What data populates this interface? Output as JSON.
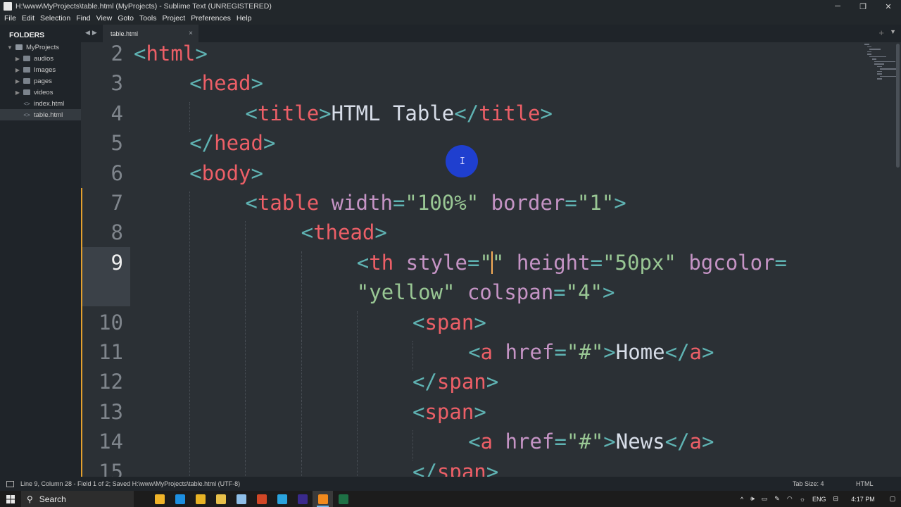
{
  "window": {
    "title": "H:\\www\\MyProjects\\table.html (MyProjects) - Sublime Text (UNREGISTERED)",
    "minimize": "─",
    "restore": "❐",
    "close": "✕"
  },
  "menu": [
    "File",
    "Edit",
    "Selection",
    "Find",
    "View",
    "Goto",
    "Tools",
    "Project",
    "Preferences",
    "Help"
  ],
  "sidebar": {
    "title": "FOLDERS",
    "project": "MyProjects",
    "folders": [
      "audios",
      "Images",
      "pages",
      "videos"
    ],
    "files": [
      "index.html",
      "table.html"
    ],
    "selected_file": "table.html"
  },
  "tabs": [
    {
      "label": "table.html",
      "active": true
    }
  ],
  "editor": {
    "lines": [
      {
        "n": "2",
        "tokens": [
          [
            "p",
            "<"
          ],
          [
            "t",
            "html"
          ],
          [
            "p",
            ">"
          ]
        ]
      },
      {
        "n": "3",
        "tokens": [
          [
            "p",
            "<"
          ],
          [
            "t",
            "head"
          ],
          [
            "p",
            ">"
          ]
        ]
      },
      {
        "n": "4",
        "tokens": [
          [
            "p",
            "<"
          ],
          [
            "t",
            "title"
          ],
          [
            "p",
            ">"
          ],
          [
            "x",
            "HTML Table"
          ],
          [
            "p",
            "</"
          ],
          [
            "t",
            "title"
          ],
          [
            "p",
            ">"
          ]
        ]
      },
      {
        "n": "5",
        "tokens": [
          [
            "p",
            "</"
          ],
          [
            "t",
            "head"
          ],
          [
            "p",
            ">"
          ]
        ]
      },
      {
        "n": "6",
        "tokens": [
          [
            "p",
            "<"
          ],
          [
            "t",
            "body"
          ],
          [
            "p",
            ">"
          ]
        ]
      },
      {
        "n": "7",
        "tokens": [
          [
            "p",
            "<"
          ],
          [
            "t",
            "table"
          ],
          [
            "x",
            " "
          ],
          [
            "a",
            "width"
          ],
          [
            "e",
            "="
          ],
          [
            "s",
            "\"100%\""
          ],
          [
            "x",
            " "
          ],
          [
            "a",
            "border"
          ],
          [
            "e",
            "="
          ],
          [
            "s",
            "\"1\""
          ],
          [
            "p",
            ">"
          ]
        ]
      },
      {
        "n": "8",
        "tokens": [
          [
            "p",
            "<"
          ],
          [
            "t",
            "thead"
          ],
          [
            "p",
            ">"
          ]
        ]
      },
      {
        "n": "9",
        "tokens": [
          [
            "p",
            "<"
          ],
          [
            "t",
            "th"
          ],
          [
            "x",
            " "
          ],
          [
            "a",
            "style"
          ],
          [
            "e",
            "="
          ],
          [
            "s",
            "\""
          ],
          [
            "caret",
            ""
          ],
          [
            "s",
            "\""
          ],
          [
            "x",
            " "
          ],
          [
            "a",
            "height"
          ],
          [
            "e",
            "="
          ],
          [
            "s",
            "\"50px\""
          ],
          [
            "x",
            " "
          ],
          [
            "a",
            "bgcolor"
          ],
          [
            "e",
            "="
          ]
        ]
      },
      {
        "n": "",
        "tokens": [
          [
            "s",
            "\"yellow\""
          ],
          [
            "x",
            " "
          ],
          [
            "a",
            "colspan"
          ],
          [
            "e",
            "="
          ],
          [
            "s",
            "\"4\""
          ],
          [
            "p",
            ">"
          ]
        ]
      },
      {
        "n": "10",
        "tokens": [
          [
            "p",
            "<"
          ],
          [
            "t",
            "span"
          ],
          [
            "p",
            ">"
          ]
        ]
      },
      {
        "n": "11",
        "tokens": [
          [
            "p",
            "<"
          ],
          [
            "t",
            "a"
          ],
          [
            "x",
            " "
          ],
          [
            "a",
            "href"
          ],
          [
            "e",
            "="
          ],
          [
            "s",
            "\"#\""
          ],
          [
            "p",
            ">"
          ],
          [
            "x",
            "Home"
          ],
          [
            "p",
            "</"
          ],
          [
            "t",
            "a"
          ],
          [
            "p",
            ">"
          ]
        ]
      },
      {
        "n": "12",
        "tokens": [
          [
            "p",
            "</"
          ],
          [
            "t",
            "span"
          ],
          [
            "p",
            ">"
          ]
        ]
      },
      {
        "n": "13",
        "tokens": [
          [
            "p",
            "<"
          ],
          [
            "t",
            "span"
          ],
          [
            "p",
            ">"
          ]
        ]
      },
      {
        "n": "14",
        "tokens": [
          [
            "p",
            "<"
          ],
          [
            "t",
            "a"
          ],
          [
            "x",
            " "
          ],
          [
            "a",
            "href"
          ],
          [
            "e",
            "="
          ],
          [
            "s",
            "\"#\""
          ],
          [
            "p",
            ">"
          ],
          [
            "x",
            "News"
          ],
          [
            "p",
            "</"
          ],
          [
            "t",
            "a"
          ],
          [
            "p",
            ">"
          ]
        ]
      },
      {
        "n": "15",
        "tokens": [
          [
            "p",
            "</"
          ],
          [
            "t",
            "span"
          ],
          [
            "p",
            ">"
          ]
        ]
      }
    ]
  },
  "status": {
    "left": "Line 9, Column 28 - Field 1 of 2; Saved H:\\www\\MyProjects\\table.html (UTF-8)",
    "tab_size": "Tab Size: 4",
    "syntax": "HTML"
  },
  "taskbar": {
    "search": "Search",
    "apps": [
      {
        "name": "file-explorer-icon",
        "color": "#f0b429"
      },
      {
        "name": "edge-icon",
        "color": "#1d8fe0"
      },
      {
        "name": "chrome-icon",
        "color": "#e8b325"
      },
      {
        "name": "folder-icon",
        "color": "#e8c04a"
      },
      {
        "name": "notes-icon",
        "color": "#8fbfe8"
      },
      {
        "name": "powerpoint-icon",
        "color": "#d24726"
      },
      {
        "name": "telegram-icon",
        "color": "#2aa3dd"
      },
      {
        "name": "after-effects-icon",
        "color": "#3a2a8c"
      },
      {
        "name": "sublime-text-icon",
        "color": "#f28a1d"
      },
      {
        "name": "excel-icon",
        "color": "#1e7145"
      }
    ],
    "language": "ENG",
    "time": "4:17 PM"
  }
}
